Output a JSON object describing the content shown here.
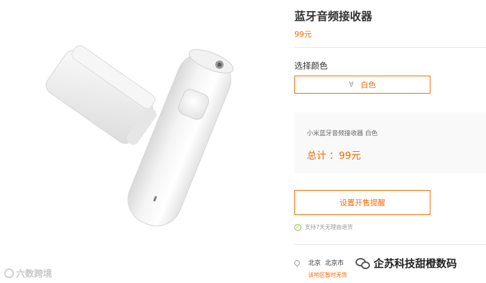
{
  "product": {
    "title": "蓝牙音频接收器",
    "price": "99元"
  },
  "color_selection": {
    "label": "选择颜色",
    "options": [
      {
        "label": "白色",
        "selected": true
      }
    ]
  },
  "summary": {
    "product_name": "小米蓝牙音频接收器 白色",
    "total_label": "总计",
    "total_value": "：99元"
  },
  "actions": {
    "remind_label": "设置开售提醒"
  },
  "policy": {
    "text": "支持7天无理由退货"
  },
  "location": {
    "province": "北京",
    "city": "北京市",
    "stock_status": "该地区暂时无货"
  },
  "watermarks": {
    "left": "六数跨境",
    "right": "企苏科技甜橙数码"
  },
  "colors": {
    "accent": "#ff6700",
    "check": "#83c44e",
    "summary_bg": "#f9f9f9"
  }
}
